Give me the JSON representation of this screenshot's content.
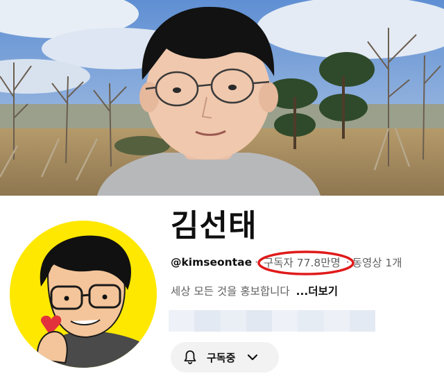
{
  "channel": {
    "name": "김선태",
    "handle": "@kimseontae",
    "separator": "·",
    "subscribers": "구독자 77.8만명",
    "videos": "동영상 1개",
    "description": "세상 모든 것을 홍보합니다",
    "more_link": "...더보기"
  },
  "subscribe_button": {
    "label": "구독중",
    "icon": "bell-icon",
    "dropdown_icon": "chevron-down-icon"
  },
  "colors": {
    "highlight_circle": "#e01a1a",
    "avatar_background": "#ffe800",
    "button_background": "#f2f2f2"
  }
}
